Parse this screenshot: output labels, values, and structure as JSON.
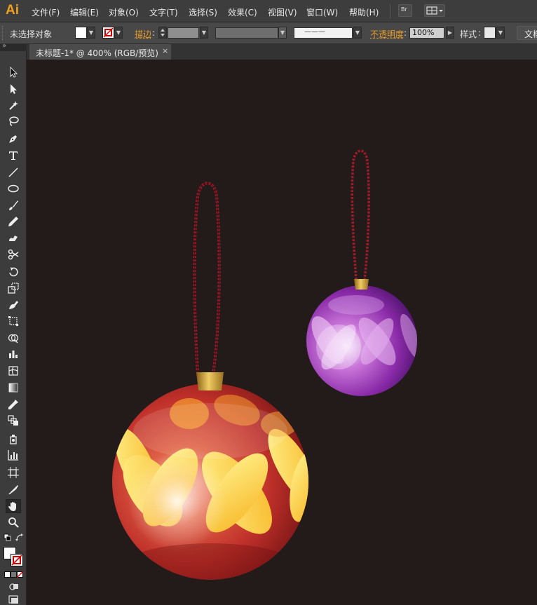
{
  "app": {
    "logo": "Ai"
  },
  "menu": [
    {
      "label": "文件(F)"
    },
    {
      "label": "编辑(E)"
    },
    {
      "label": "对象(O)"
    },
    {
      "label": "文字(T)"
    },
    {
      "label": "选择(S)"
    },
    {
      "label": "效果(C)"
    },
    {
      "label": "视图(V)"
    },
    {
      "label": "窗口(W)"
    },
    {
      "label": "帮助(H)"
    }
  ],
  "menu_right": {
    "bridge_label": "Br"
  },
  "control": {
    "selection_status": "未选择对象",
    "stroke_label": "描边",
    "stroke_dash_preview": "———",
    "opacity_label": "不透明度",
    "opacity_value": "100%",
    "style_label": "样式",
    "doc_button": "文档"
  },
  "document": {
    "tab_title": "未标题-1* @ 400% (RGB/预览)",
    "close_glyph": "×"
  },
  "toolbar": {
    "collapse_glyph": "»",
    "tools": [
      "selection-tool",
      "direct-selection-tool",
      "magic-wand-tool",
      "lasso-tool",
      "pen-tool",
      "type-tool",
      "line-segment-tool",
      "ellipse-tool",
      "paintbrush-tool",
      "pencil-tool",
      "blob-brush-tool",
      "scissors-tool",
      "rotate-tool",
      "scale-tool",
      "warp-tool",
      "free-transform-tool",
      "shape-builder-tool",
      "column-graph-tool",
      "mesh-tool",
      "gradient-tool",
      "eyedropper-tool",
      "blend-tool",
      "symbol-sprayer-tool",
      "graph-tool",
      "artboard-tool",
      "slice-tool",
      "hand-tool",
      "zoom-tool"
    ]
  },
  "colors": {
    "background": "#231a1a",
    "accent_orange": "#e69a2a",
    "large_ornament": "#c0302a",
    "small_ornament": "#8a2aa8",
    "string": "#a01a2a",
    "cap": "#c89a30"
  }
}
